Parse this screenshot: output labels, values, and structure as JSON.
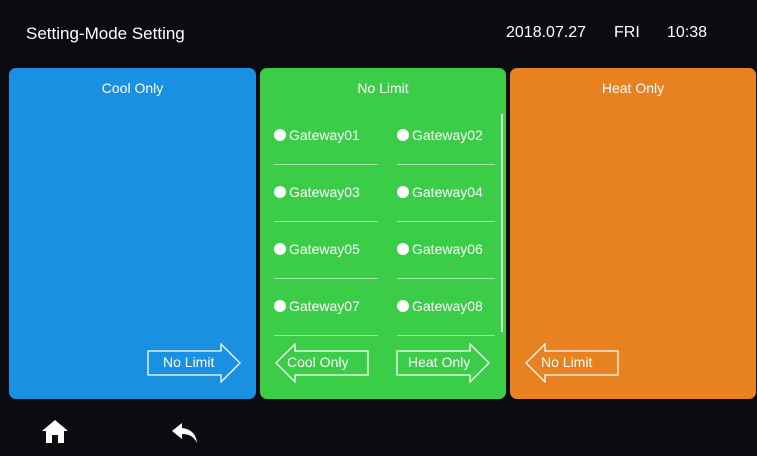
{
  "header": {
    "title": "Setting-Mode Setting",
    "date": "2018.07.27",
    "weekday": "FRI",
    "time": "10:38"
  },
  "panels": {
    "cool": {
      "title": "Cool Only",
      "color": "#1a90e2",
      "button": "No Limit"
    },
    "nolimit": {
      "title": "No Limit",
      "color": "#3bcc48",
      "gateways": [
        "Gateway01",
        "Gateway02",
        "Gateway03",
        "Gateway04",
        "Gateway05",
        "Gateway06",
        "Gateway07",
        "Gateway08"
      ],
      "left_button": "Cool Only",
      "right_button": "Heat Only"
    },
    "heat": {
      "title": "Heat Only",
      "color": "#e8811f",
      "button": "No Limit"
    }
  },
  "footer": {
    "icons": [
      "home-icon",
      "back-icon"
    ]
  }
}
